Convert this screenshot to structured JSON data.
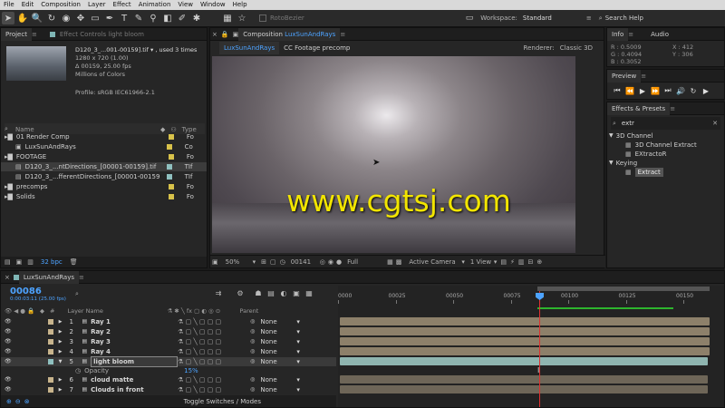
{
  "menu": [
    "File",
    "Edit",
    "Composition",
    "Layer",
    "Effect",
    "Animation",
    "View",
    "Window",
    "Help"
  ],
  "toolbar": {
    "rotobezier_label": "RotoBezier",
    "workspace_label": "Workspace:",
    "workspace_value": "Standard",
    "search_placeholder": "Search Help"
  },
  "project": {
    "tab_label": "Project",
    "effect_controls_label": "Effect Controls",
    "effect_controls_layer": "light bloom",
    "file_name": "D120_3_...001-00159].tif ▾ , used 3 times",
    "resolution": "1280 x 720 (1.00)",
    "duration": "Δ 00159, 25.00 fps",
    "colors": "Millions of Colors",
    "profile": "Profile: sRGB IEC61966-2.1",
    "col_name": "Name",
    "col_type": "Type",
    "bpc": "32 bpc",
    "items": [
      {
        "name": "01 Render Comp",
        "type": "Fo",
        "indent": 0,
        "kind": "folder",
        "color": "#d8c24a"
      },
      {
        "name": "LuxSunAndRays",
        "type": "Co",
        "indent": 1,
        "kind": "comp",
        "color": "#d8c24a"
      },
      {
        "name": "FOOTAGE",
        "type": "Fo",
        "indent": 0,
        "kind": "folder",
        "color": "#d8c24a"
      },
      {
        "name": "D120_3_...ntDirections_[00001-00159].tif",
        "type": "TIf",
        "indent": 1,
        "kind": "footage",
        "color": "#8fc0bf",
        "selected": true
      },
      {
        "name": "D120_3_...fferentDirections_[00001-00159].tif",
        "type": "TIf",
        "indent": 1,
        "kind": "footage",
        "color": "#8fc0bf"
      },
      {
        "name": "precomps",
        "type": "Fo",
        "indent": 0,
        "kind": "folder",
        "color": "#d8c24a"
      },
      {
        "name": "Solids",
        "type": "Fo",
        "indent": 0,
        "kind": "folder",
        "color": "#d8c24a"
      }
    ]
  },
  "composition": {
    "panel_label": "Composition",
    "comp_name": "LuxSunAndRays",
    "tab_active": "LuxSunAndRays",
    "tab_other": "CC Footage precomp",
    "renderer_label": "Renderer:",
    "renderer_value": "Classic 3D",
    "zoom": "50%",
    "timecode": "00141",
    "resolution": "Full",
    "camera": "Active Camera",
    "views": "1 View",
    "watermark": "www.cgtsj.com"
  },
  "info": {
    "tab_label": "Info",
    "audio_label": "Audio",
    "r": "R : 0.5009",
    "g": "G : 0.4094",
    "b": "B : 0.3052",
    "x": "X : 412",
    "y": "Y : 306"
  },
  "preview": {
    "tab_label": "Preview"
  },
  "effects": {
    "tab_label": "Effects & Presets",
    "search_value": "extr",
    "groups": [
      {
        "name": "3D Channel",
        "items": [
          "3D Channel Extract",
          "EXtractoR"
        ]
      },
      {
        "name": "Keying",
        "items": [
          "Extract"
        ]
      }
    ]
  },
  "timeline": {
    "tab_label": "LuxSunAndRays",
    "timecode": "00086",
    "timecode_sub": "0:00:03:11 (25.00 fps)",
    "col_layer_name": "Layer Name",
    "col_parent": "Parent",
    "toggle_label": "Toggle Switches / Modes",
    "ruler": [
      "0000",
      "00025",
      "00050",
      "00075",
      "00100",
      "00125",
      "00150"
    ],
    "opacity_label": "Opacity",
    "opacity_value": "15%",
    "layers": [
      {
        "num": "1",
        "name": "Ray 1",
        "parent": "None",
        "color": "#c8b48c"
      },
      {
        "num": "2",
        "name": "Ray 2",
        "parent": "None",
        "color": "#c8b48c"
      },
      {
        "num": "3",
        "name": "Ray 3",
        "parent": "None",
        "color": "#c8b48c"
      },
      {
        "num": "4",
        "name": "Ray 4",
        "parent": "None",
        "color": "#c8b48c"
      },
      {
        "num": "5",
        "name": "light bloom",
        "parent": "None",
        "color": "#8fc0bf",
        "selected": true
      },
      {
        "num": "6",
        "name": "cloud matte",
        "parent": "None",
        "color": "#c8b48c"
      },
      {
        "num": "7",
        "name": "Clouds in front",
        "parent": "None",
        "color": "#c8b48c"
      }
    ]
  }
}
